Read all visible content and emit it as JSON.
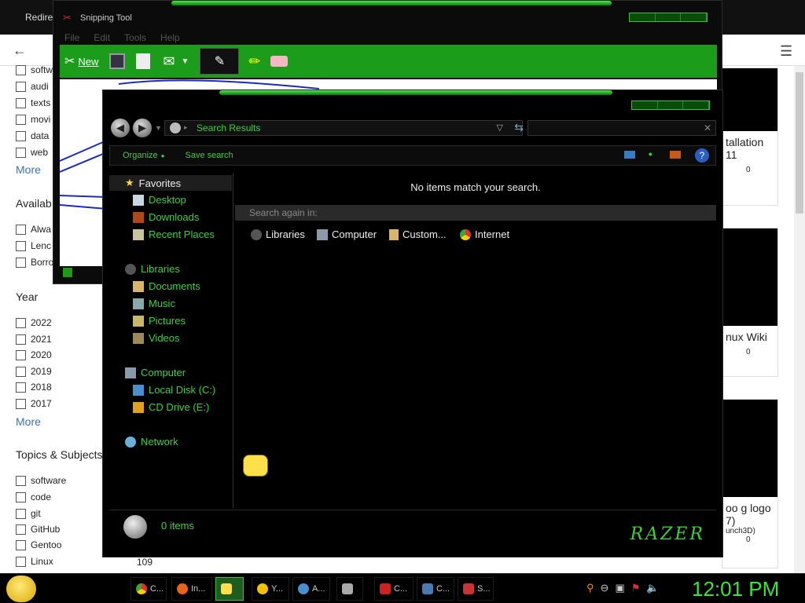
{
  "browser": {
    "tab_title": "Redire",
    "filters": {
      "media": [
        "softw",
        "audi",
        "texts",
        "movi",
        "data",
        "web"
      ],
      "more_1": "More",
      "availability_heading": "Availab",
      "availability": [
        "Alwa",
        "Lenc",
        "Borro"
      ],
      "year_heading": "Year",
      "years": [
        "2022",
        "2021",
        "2020",
        "2019",
        "2018",
        "2017"
      ],
      "more_2": "More",
      "topics_heading": "Topics & Subjects",
      "topics": [
        "software",
        "code",
        "git",
        "GitHub",
        "Gentoo",
        "Linux"
      ],
      "linux_count": "109"
    },
    "cards": [
      {
        "text": "tallation\n11",
        "count": "0"
      },
      {
        "text": "nux Wiki",
        "count": "0"
      },
      {
        "text": "oo g logo\n7)",
        "sub": "unch3D)",
        "count": "0"
      }
    ]
  },
  "snipping_tool": {
    "title": "Snipping Tool",
    "menu": [
      "File",
      "Edit",
      "Tools",
      "Help"
    ],
    "new_label": "New"
  },
  "explorer": {
    "address": "Search Results",
    "commands": {
      "organize": "Organize",
      "save_search": "Save search"
    },
    "nav": {
      "favorites": "Favorites",
      "desktop": "Desktop",
      "downloads": "Downloads",
      "recent": "Recent Places",
      "libraries": "Libraries",
      "documents": "Documents",
      "music": "Music",
      "pictures": "Pictures",
      "videos": "Videos",
      "computer": "Computer",
      "local_disk": "Local Disk (C:)",
      "cd_drive": "CD Drive (E:)",
      "network": "Network"
    },
    "no_match": "No items match your search.",
    "search_again": "Search again in:",
    "locations": [
      "Libraries",
      "Computer",
      "Custom...",
      "Internet"
    ],
    "item_count": "0 items",
    "logo": "RAZER"
  },
  "taskbar": {
    "tasks": [
      "C...",
      "In...",
      "",
      "Y...",
      "A...",
      "",
      "C...",
      "C...",
      "S..."
    ],
    "clock": "12:01 PM"
  },
  "colors": {
    "accent_green": "#3dd13d",
    "toolbar_green": "#1b9c1b",
    "link_blue": "#3a6ec1"
  }
}
